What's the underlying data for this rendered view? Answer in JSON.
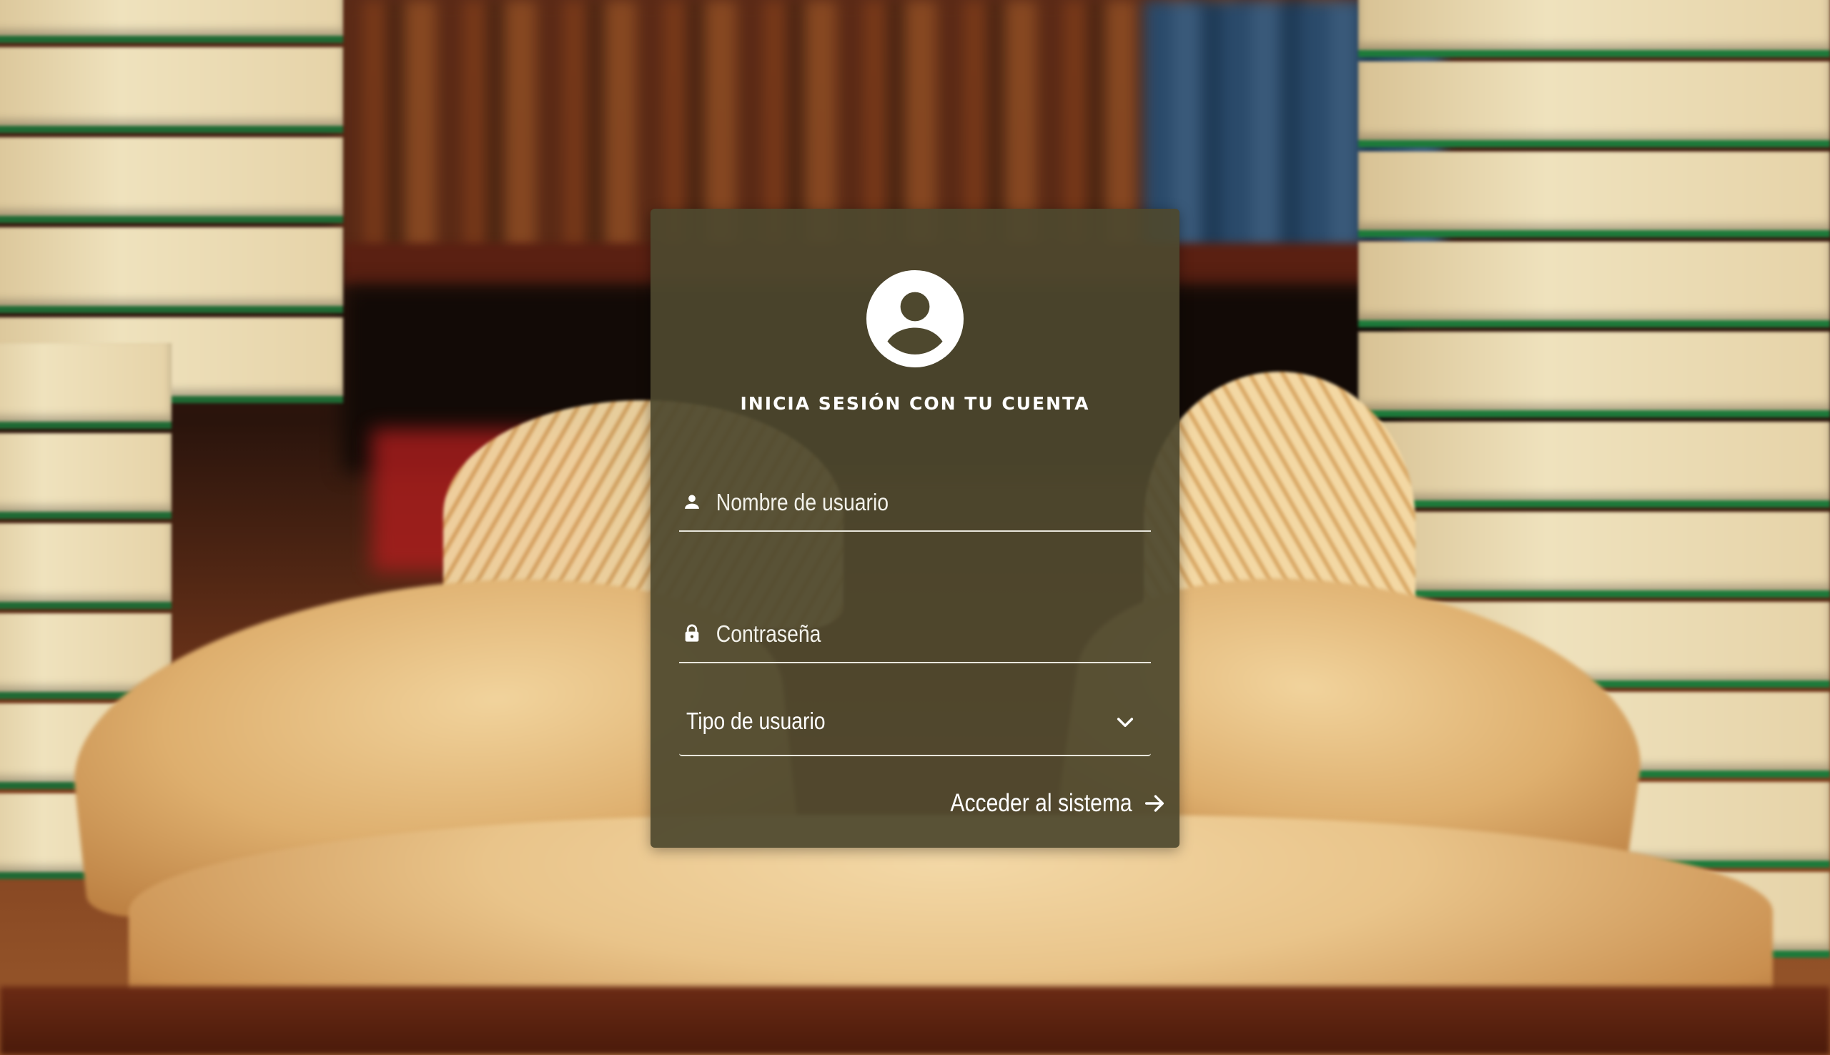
{
  "login": {
    "title": "INICIA SESIÓN CON TU CUENTA",
    "username": {
      "placeholder": "Nombre de usuario",
      "value": ""
    },
    "password": {
      "placeholder": "Contraseña",
      "value": ""
    },
    "user_type": {
      "selected": "Tipo de usuario"
    },
    "submit_label": "Acceder al sistema"
  },
  "icons": {
    "avatar": "account-circle-icon",
    "username": "person-icon",
    "password": "lock-icon",
    "user_type": "chevron-down-icon",
    "submit": "arrow-right-icon"
  },
  "colors": {
    "card_background": "#4e482e",
    "text": "#ffffff"
  }
}
